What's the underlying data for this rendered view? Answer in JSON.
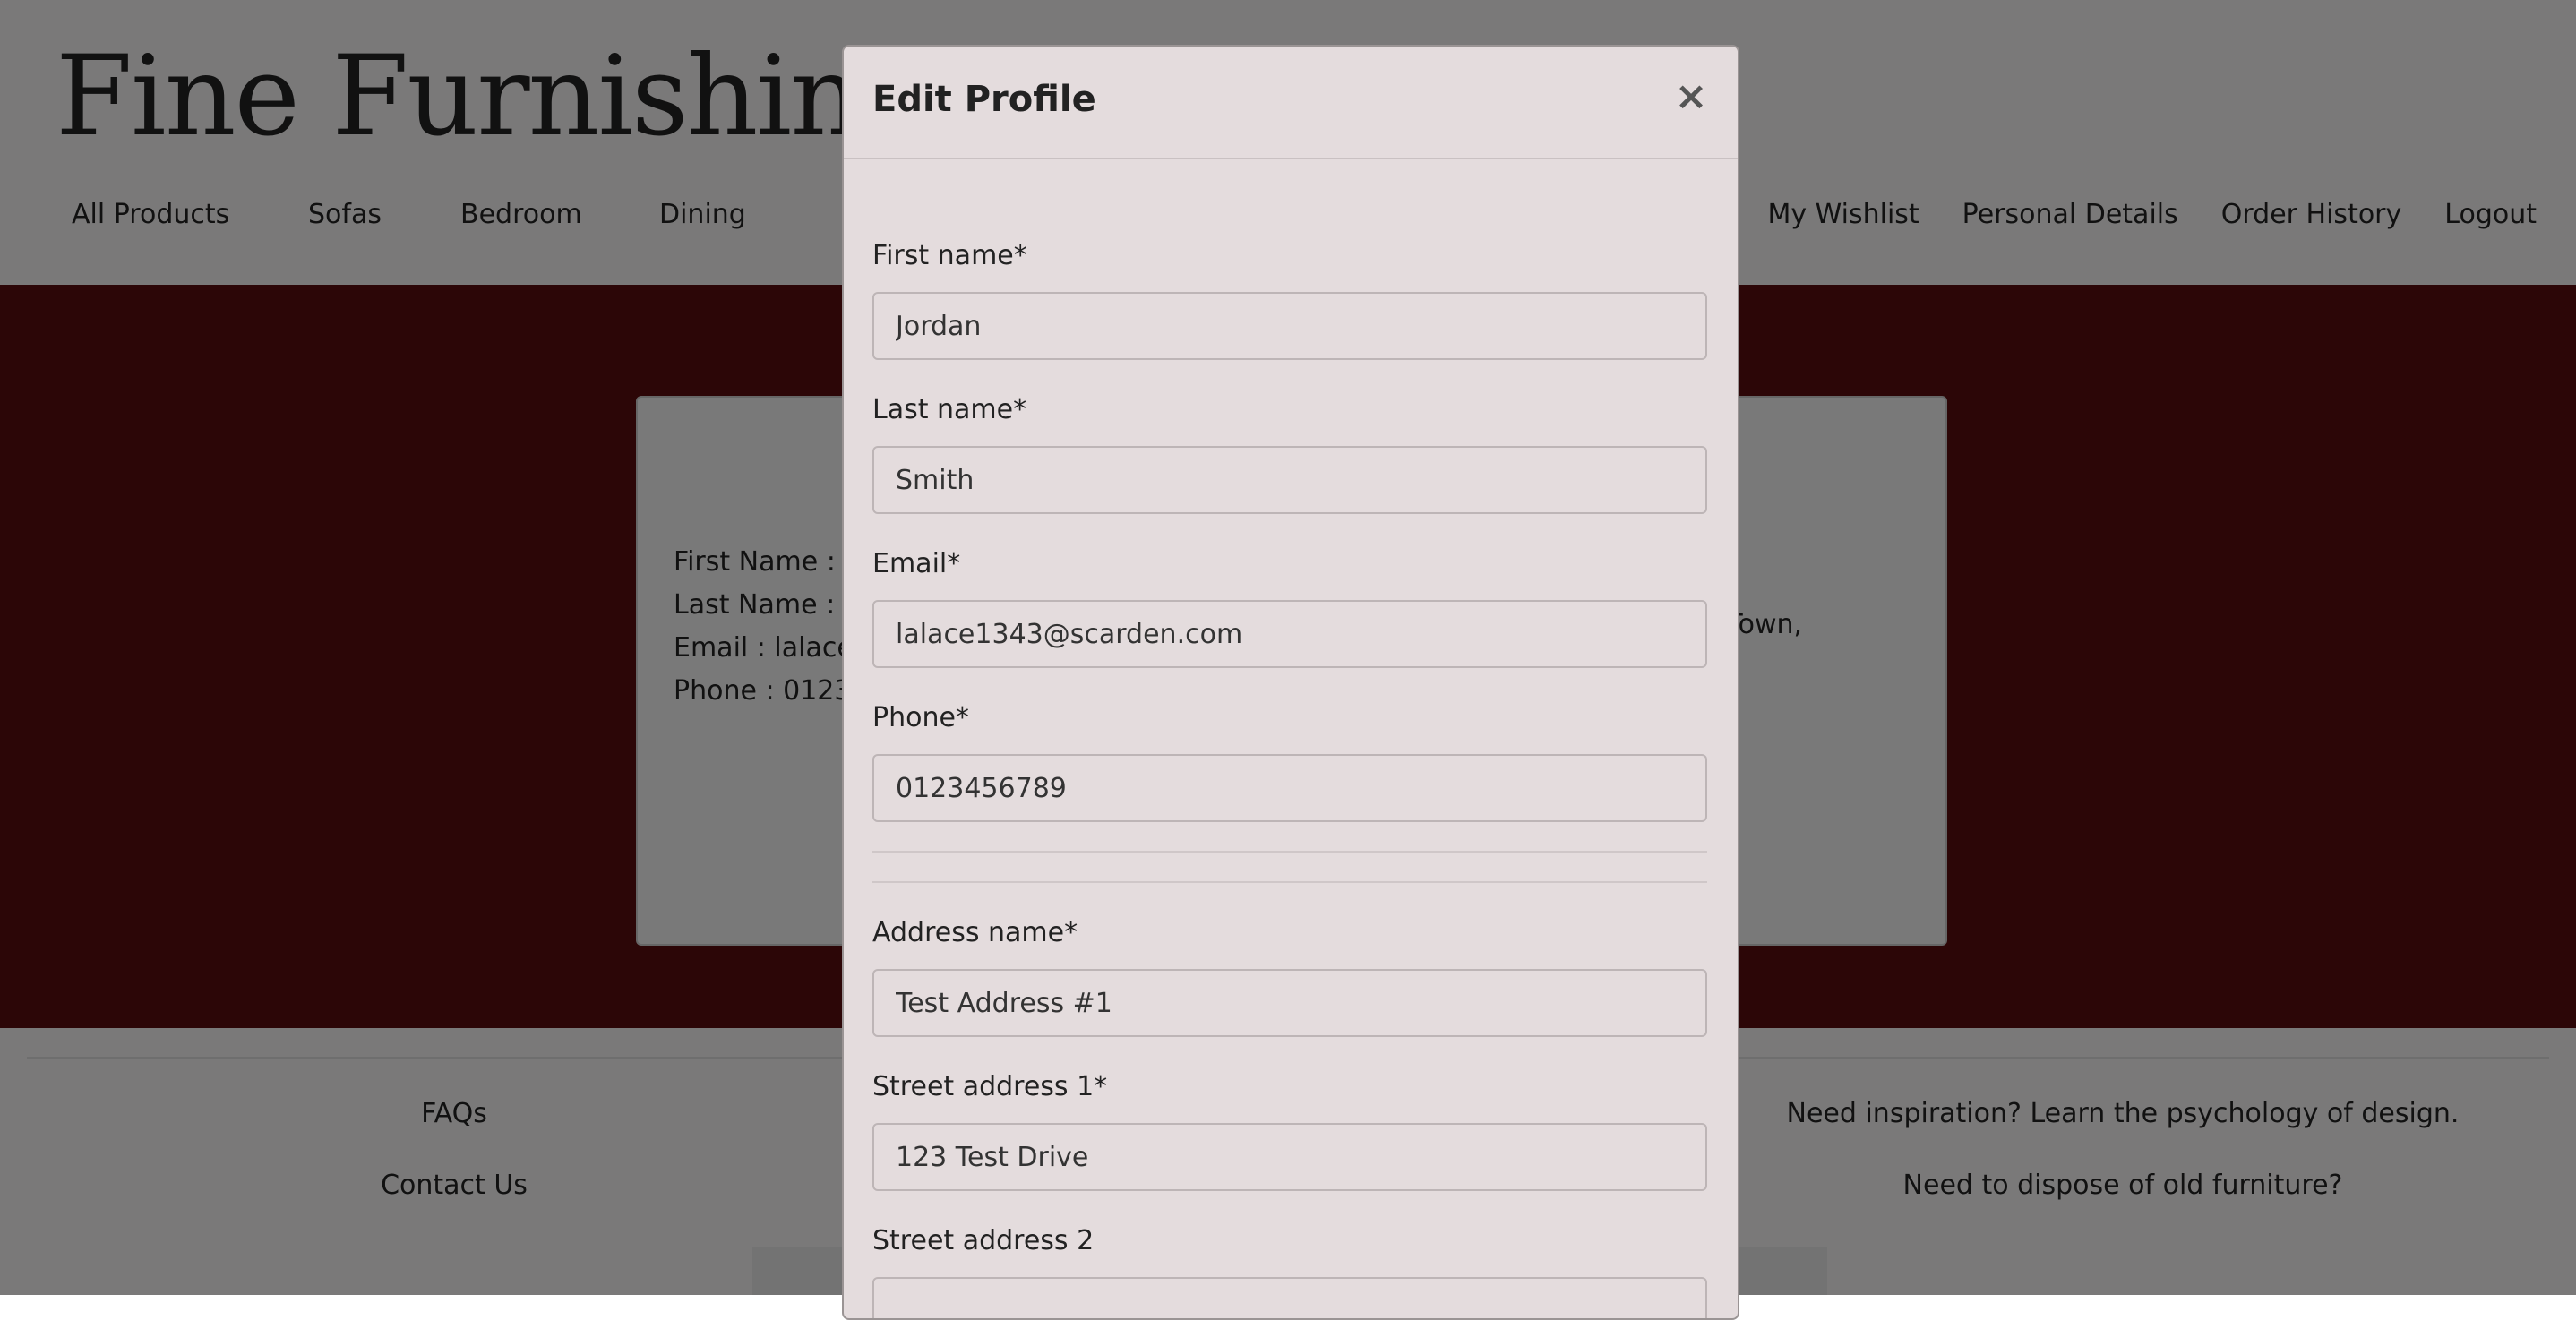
{
  "brand": {
    "name": "Fine Furnishings"
  },
  "nav": {
    "left": [
      "All Products",
      "Sofas",
      "Bedroom",
      "Dining"
    ],
    "right": [
      "My Wishlist",
      "Personal Details",
      "Order History",
      "Logout"
    ]
  },
  "profile_card": {
    "lines": [
      "First Name : J",
      "Last Name : S",
      "Email : lalace1",
      "Phone : 01234"
    ],
    "address_fragment": "est Town,"
  },
  "footer": {
    "left_links": [
      "FAQs",
      "Contact Us"
    ],
    "right_links": [
      "Need inspiration? Learn the psychology of design.",
      "Need to dispose of old furniture?"
    ]
  },
  "modal": {
    "title": "Edit Profile",
    "close_symbol": "×",
    "fields": {
      "first_name": {
        "label": "First name*",
        "value": "Jordan"
      },
      "last_name": {
        "label": "Last name*",
        "value": "Smith"
      },
      "email": {
        "label": "Email*",
        "value": "lalace1343@scarden.com"
      },
      "phone": {
        "label": "Phone*",
        "value": "0123456789"
      },
      "address_name": {
        "label": "Address name*",
        "value": "Test Address #1"
      },
      "street1": {
        "label": "Street address 1*",
        "value": "123 Test Drive"
      },
      "street2": {
        "label": "Street address 2",
        "value": ""
      }
    }
  },
  "colors": {
    "hero": "#590d0e",
    "modal_bg": "#e4dcdd",
    "header_bg": "#f5f3f3",
    "backdrop": "rgba(0,0,0,0.5)"
  }
}
